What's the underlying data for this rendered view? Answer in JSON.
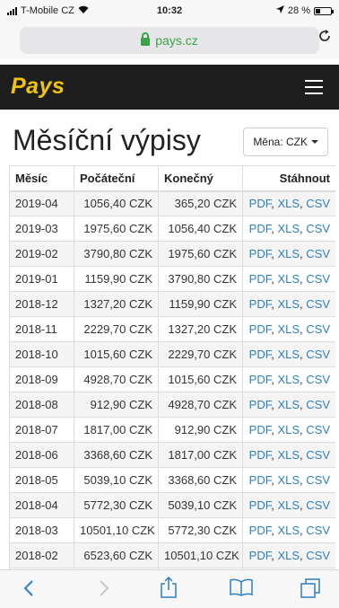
{
  "status": {
    "carrier": "T-Mobile CZ",
    "time": "10:32",
    "battery": "28 %",
    "battery_fraction": 0.28
  },
  "browser": {
    "url": "pays.cz"
  },
  "nav": {
    "logo": "Pays"
  },
  "page": {
    "title": "Měsíční výpisy",
    "currency_label": "Měna: CZK"
  },
  "table": {
    "headers": [
      "Měsíc",
      "Počáteční",
      "Konečný",
      "Stáhnout"
    ],
    "link_labels": [
      "PDF",
      "XLS",
      "CSV"
    ],
    "rows": [
      [
        "2019-04",
        "1056,40 CZK",
        "365,20 CZK"
      ],
      [
        "2019-03",
        "1975,60 CZK",
        "1056,40 CZK"
      ],
      [
        "2019-02",
        "3790,80 CZK",
        "1975,60 CZK"
      ],
      [
        "2019-01",
        "1159,90 CZK",
        "3790,80 CZK"
      ],
      [
        "2018-12",
        "1327,20 CZK",
        "1159,90 CZK"
      ],
      [
        "2018-11",
        "2229,70 CZK",
        "1327,20 CZK"
      ],
      [
        "2018-10",
        "1015,60 CZK",
        "2229,70 CZK"
      ],
      [
        "2018-09",
        "4928,70 CZK",
        "1015,60 CZK"
      ],
      [
        "2018-08",
        "912,90 CZK",
        "4928,70 CZK"
      ],
      [
        "2018-07",
        "1817,00 CZK",
        "912,90 CZK"
      ],
      [
        "2018-06",
        "3368,60 CZK",
        "1817,00 CZK"
      ],
      [
        "2018-05",
        "5039,10 CZK",
        "3368,60 CZK"
      ],
      [
        "2018-04",
        "5772,30 CZK",
        "5039,10 CZK"
      ],
      [
        "2018-03",
        "10501,10 CZK",
        "5772,30 CZK"
      ],
      [
        "2018-02",
        "6523,60 CZK",
        "10501,10 CZK"
      ],
      [
        "",
        "",
        ""
      ]
    ]
  },
  "colors": {
    "accent": "#2f7fc1",
    "logo": "#f0c30e",
    "nav_bg": "#1e1e1e",
    "secure": "#3aa24a"
  },
  "toolbar": {
    "icons": [
      "back-icon",
      "forward-icon",
      "share-icon",
      "bookmarks-icon",
      "tabs-icon"
    ]
  }
}
